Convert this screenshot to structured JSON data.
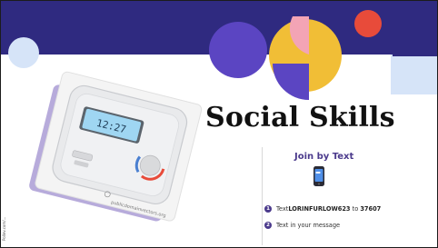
{
  "slide": {
    "title": "Social Skills",
    "join": {
      "heading": "Join by Text",
      "step1_prefix": "Text ",
      "step1_code": "LORINFURLOW623",
      "step1_middle": " to ",
      "step1_number": "37607",
      "step2_text": "Text in your message",
      "step1_num": "1",
      "step2_num": "2"
    },
    "device": {
      "clock": "12:27",
      "watermark": "publicdomainvectors.org"
    },
    "side_caption": "Pollev.com/..."
  },
  "colors": {
    "banner": "#2f2a80",
    "purple_accent": "#5b45c2",
    "yellow": "#f1be36",
    "coral": "#e84b3a",
    "pink": "#f3a4b5",
    "light_blue": "#d6e4f8"
  },
  "icons": {
    "phone": "phone-icon",
    "clock": "thermostat-clock"
  }
}
